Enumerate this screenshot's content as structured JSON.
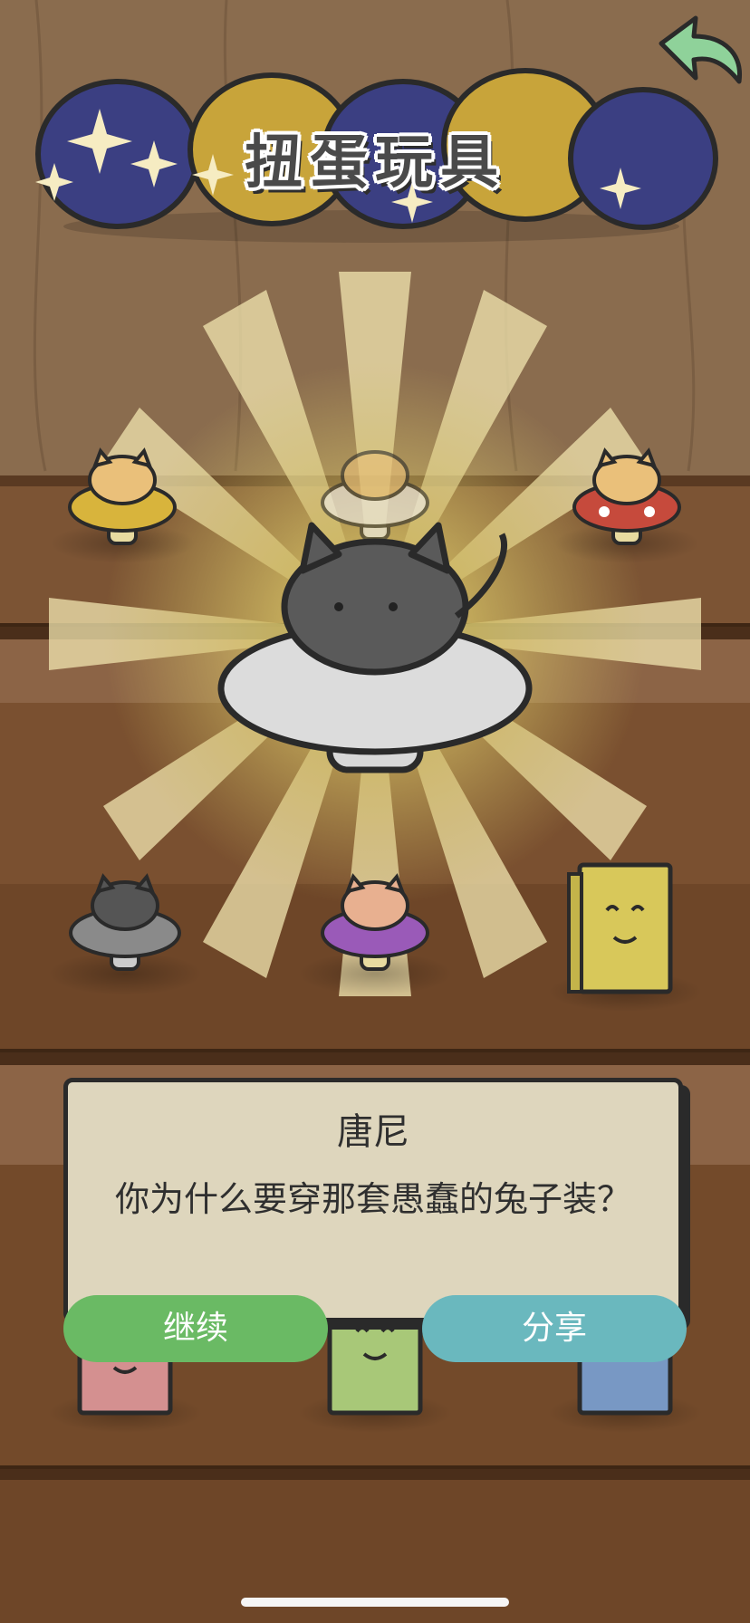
{
  "header": {
    "title": "扭蛋玩具",
    "back_icon": "back-arrow-icon"
  },
  "colors": {
    "wood_bg": "#8a6a4c",
    "shelf": "#7a4a2c",
    "capsule_blue": "#3b3f82",
    "capsule_yellow": "#c8a43a",
    "dialog_bg": "#ded6bd",
    "continue_green": "#6aba64",
    "share_teal": "#6ab8be"
  },
  "dialog": {
    "name": "唐尼",
    "message": "你为什么要穿那套愚蠢的兔子装？"
  },
  "buttons": {
    "continue_label": "继续",
    "share_label": "分享"
  },
  "shelf_items": [
    {
      "name": "yellow-mushroom-cat-toy",
      "icon": "cat-on-mushroom-icon"
    },
    {
      "name": "white-mushroom-cat-toy",
      "icon": "cat-on-mushroom-icon"
    },
    {
      "name": "red-mushroom-cat-toy",
      "icon": "cat-on-mushroom-icon"
    },
    {
      "name": "gray-mushroom-cat-toy",
      "icon": "cat-on-mushroom-icon"
    },
    {
      "name": "purple-mushroom-cat-toy",
      "icon": "cat-on-mushroom-icon"
    },
    {
      "name": "yellow-book-toy",
      "icon": "smiling-book-icon"
    },
    {
      "name": "pink-book-toy",
      "icon": "smiling-book-icon"
    },
    {
      "name": "green-book-toy",
      "icon": "smiling-book-icon"
    },
    {
      "name": "blue-book-toy",
      "icon": "smiling-book-icon"
    }
  ],
  "featured_item": {
    "name": "featured-gray-mushroom-cat",
    "icon": "cat-on-mushroom-icon"
  }
}
